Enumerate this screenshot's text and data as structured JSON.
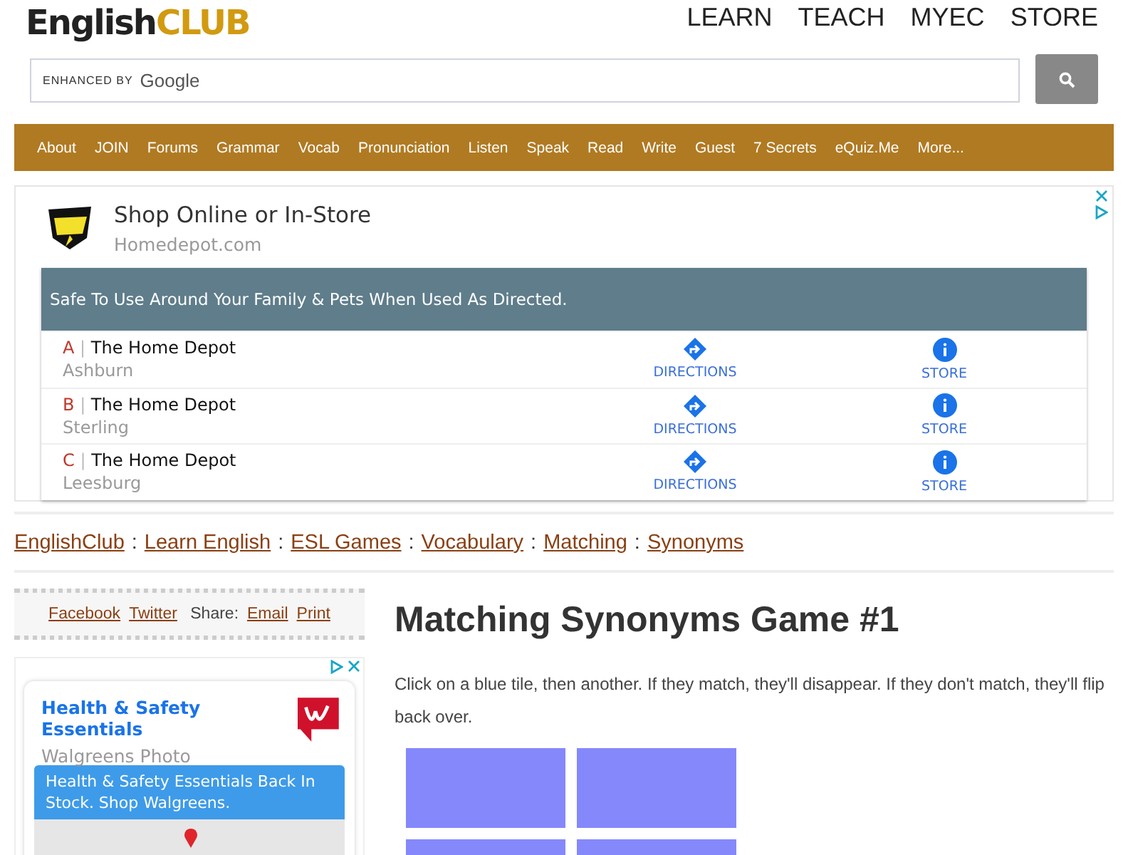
{
  "logo": {
    "part1": "English",
    "part2": "CLUB"
  },
  "top_nav": [
    "LEARN",
    "TEACH",
    "MYEC",
    "STORE"
  ],
  "search": {
    "brand_prefix": "ENHANCED BY",
    "brand": "Google"
  },
  "menu": [
    "About",
    "JOIN",
    "Forums",
    "Grammar",
    "Vocab",
    "Pronunciation",
    "Listen",
    "Speak",
    "Read",
    "Write",
    "Guest",
    "7 Secrets",
    "eQuiz.Me",
    "More..."
  ],
  "ad": {
    "headline": "Shop Online or In-Store",
    "domain": "Homedepot.com",
    "banner": "Safe To Use Around Your Family & Pets When Used As Directed.",
    "locations": [
      {
        "letter": "A",
        "separator": "|",
        "name": "The Home Depot",
        "city": "Ashburn",
        "directions": "DIRECTIONS",
        "store": "STORE"
      },
      {
        "letter": "B",
        "separator": "|",
        "name": "The Home Depot",
        "city": "Sterling",
        "directions": "DIRECTIONS",
        "store": "STORE"
      },
      {
        "letter": "C",
        "separator": "|",
        "name": "The Home Depot",
        "city": "Leesburg",
        "directions": "DIRECTIONS",
        "store": "STORE"
      }
    ]
  },
  "breadcrumb": {
    "separator": ":",
    "items": [
      "EnglishClub",
      "Learn English",
      "ESL Games",
      "Vocabulary",
      "Matching",
      "Synonyms"
    ]
  },
  "share": {
    "links": [
      "Facebook",
      "Twitter"
    ],
    "label": "Share:",
    "actions": [
      "Email",
      "Print"
    ]
  },
  "side_ad": {
    "headline": "Health & Safety Essentials",
    "advertiser": "Walgreens Photo",
    "banner": "Health & Safety Essentials Back In Stock. Shop Walgreens."
  },
  "game": {
    "title": "Matching Synonyms Game #1",
    "instructions": "Click on a blue tile, then another. If they match, they'll disappear. If they don't match, they'll flip back over.",
    "tiles": [
      {
        "flipped": false
      },
      {
        "flipped": false
      },
      {
        "flipped": false
      },
      {
        "flipped": false
      }
    ]
  }
}
